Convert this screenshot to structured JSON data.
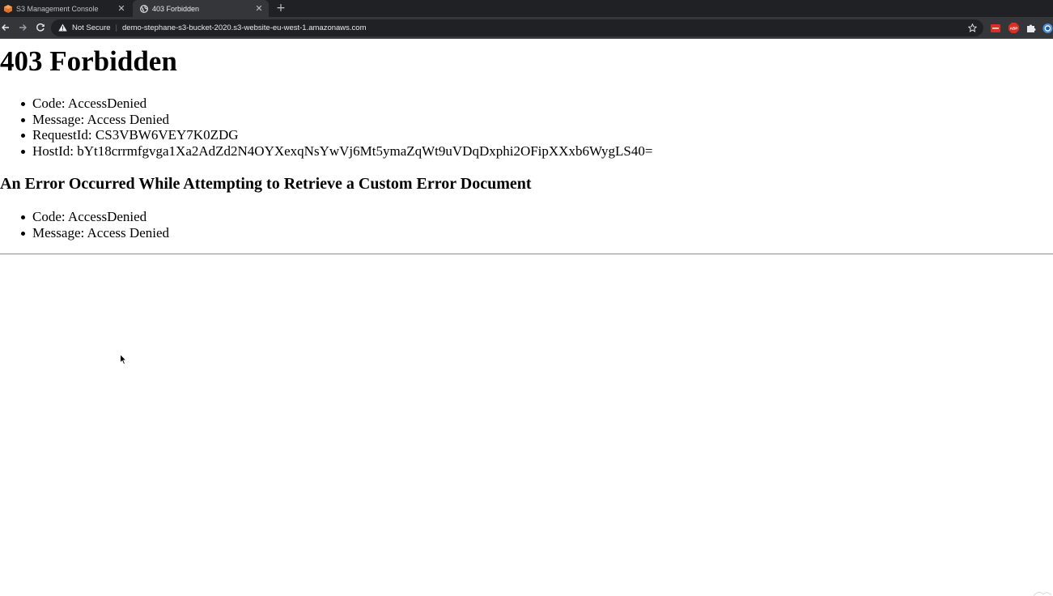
{
  "browser": {
    "tabs": [
      {
        "title": "S3 Management Console",
        "active": false,
        "favicon": "aws-cube-icon"
      },
      {
        "title": "403 Forbidden",
        "active": true,
        "favicon": "globe-icon"
      }
    ],
    "new_tab_label": "+",
    "tab_close_label": "✕",
    "address_bar": {
      "security_label": "Not Secure",
      "separator": "|",
      "url": "demo-stephane-s3-bucket-2020.s3-website-eu-west-1.amazonaws.com"
    },
    "icons": [
      "back-arrow-icon",
      "forward-arrow-icon",
      "reload-icon",
      "warning-icon",
      "star-icon",
      "extension-icon",
      "adblock-icon",
      "puzzle-icon",
      "profile-icon"
    ],
    "colors": {
      "tabbar": "#202124",
      "toolbar": "#35363a",
      "ext_red": "#d93025"
    }
  },
  "page": {
    "heading": "403 Forbidden",
    "details": [
      "Code: AccessDenied",
      "Message: Access Denied",
      "RequestId: CS3VBW6VEY7K0ZDG",
      "HostId: bYt18crrmfgvga1Xa2AdZd2N4OYXexqNsYwVj6Mt5ymaZqWt9uVDqDxphi2OFipXXxb6WygLS40="
    ],
    "subheading": "An Error Occurred While Attempting to Retrieve a Custom Error Document",
    "sub_details": [
      "Code: AccessDenied",
      "Message: Access Denied"
    ]
  }
}
